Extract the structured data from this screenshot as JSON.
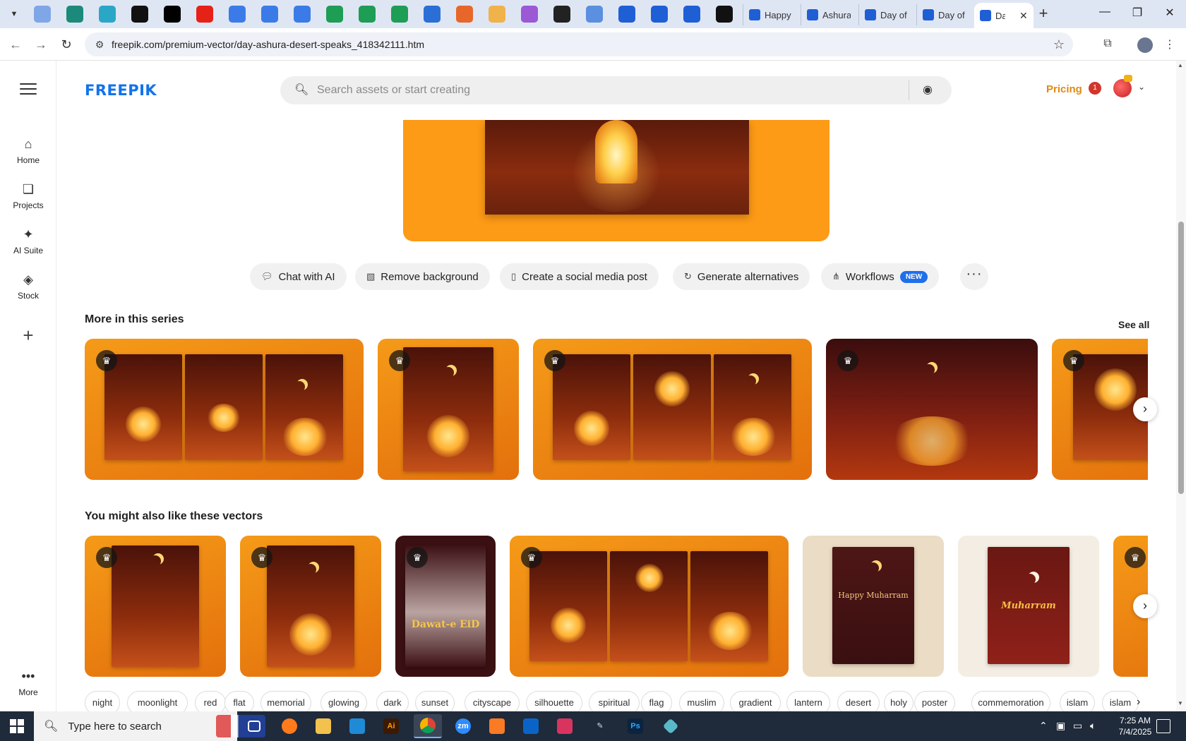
{
  "browser": {
    "tabs": [
      {
        "label": "Happy"
      },
      {
        "label": "Ashura"
      },
      {
        "label": "Day of"
      },
      {
        "label": "Day of"
      },
      {
        "label": "Da"
      }
    ],
    "url": "freepik.com/premium-vector/day-ashura-desert-speaks_418342111.htm"
  },
  "rail": {
    "items": [
      {
        "label": "Home",
        "icon": "home-icon"
      },
      {
        "label": "Projects",
        "icon": "projects-icon"
      },
      {
        "label": "AI Suite",
        "icon": "sparkles-icon"
      },
      {
        "label": "Stock",
        "icon": "stock-icon"
      }
    ],
    "more_label": "More"
  },
  "header": {
    "logo": "FREEPIK",
    "search_placeholder": "Search assets or start creating",
    "pricing": "Pricing",
    "notification_count": "1"
  },
  "actions": [
    {
      "label": "Chat with AI",
      "icon": "chat-icon"
    },
    {
      "label": "Remove background",
      "icon": "remove-bg-icon"
    },
    {
      "label": "Create a social media post",
      "icon": "phone-icon"
    },
    {
      "label": "Generate alternatives",
      "icon": "refresh-icon"
    },
    {
      "label": "Workflows",
      "icon": "workflow-icon",
      "badge": "NEW"
    }
  ],
  "series": {
    "title": "More in this series",
    "see_all": "See all"
  },
  "similar": {
    "title": "You might also like these vectors",
    "poster_texts": {
      "eid": "Dawat-e EiD",
      "happy_muharram": "Happy Muharram",
      "muharram": "Muharram"
    }
  },
  "tags": [
    "night",
    "moonlight",
    "red",
    "flat",
    "memorial",
    "glowing",
    "dark",
    "sunset",
    "cityscape",
    "silhouette",
    "spiritual",
    "flag",
    "muslim",
    "gradient",
    "lantern",
    "desert",
    "holy",
    "poster",
    "commemoration",
    "islam",
    "islam"
  ],
  "taskbar": {
    "search_text": "Type here to search",
    "time": "7:25 AM",
    "date": "7/4/2025"
  },
  "colors": {
    "brand_blue": "#1273eb",
    "pricing_orange": "#e08a14",
    "card_orange": "#f59a18",
    "new_badge": "#1f6feb"
  }
}
